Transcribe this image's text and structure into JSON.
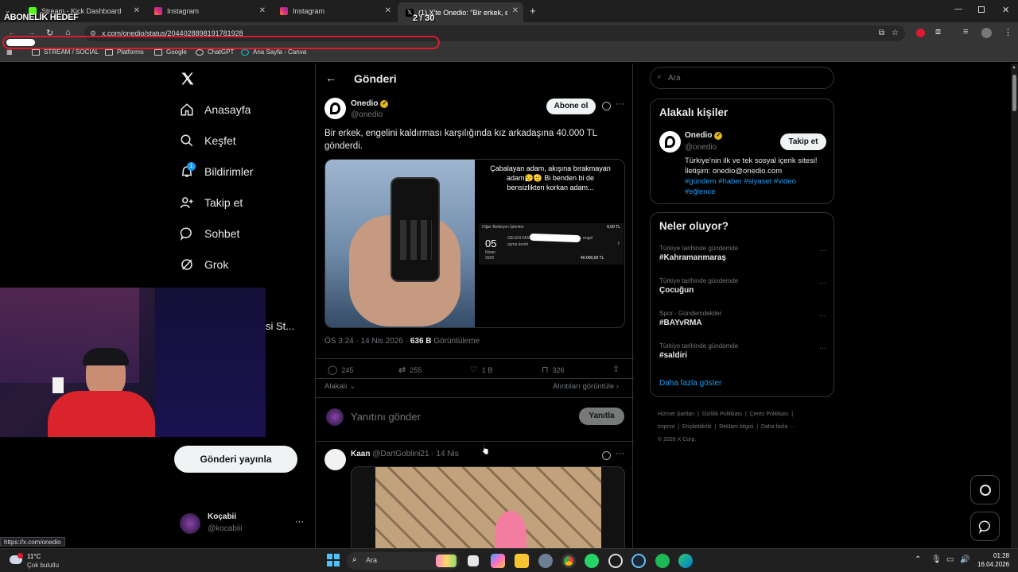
{
  "overlay": {
    "title": "ABONELİK HEDEF",
    "counter": "2 / 30",
    "progress": 0.067
  },
  "browser": {
    "tabs": [
      {
        "label": "Stream - Kick Dashboard",
        "active": false,
        "color": "#53fc18"
      },
      {
        "label": "Instagram",
        "active": false,
        "color": "#d6249f"
      },
      {
        "label": "Instagram",
        "active": false,
        "color": "#d6249f"
      },
      {
        "label": "(1) X'te Onedio: \"Bir erkek, eng",
        "active": true,
        "color": "#ffffff"
      }
    ],
    "url": "x.com/onedio/status/2044028898191781928",
    "bookmarks": [
      "STREAM / SOCIAL",
      "Platforms",
      "Google",
      "ChatGPT",
      "Ana Sayfa - Canva"
    ],
    "status_url": "https://x.com/onedio"
  },
  "nav": {
    "items": [
      "Anasayfa",
      "Keşfet",
      "Bildirimler",
      "Takip et",
      "Sohbet",
      "Grok"
    ],
    "notif_badge": "1",
    "post_button": "Gönderi yayınla",
    "partial_label": "si St...",
    "account": {
      "name": "Koçabii",
      "handle": "@kocabiii",
      "more": "···"
    }
  },
  "post": {
    "header_title": "Gönderi",
    "author": {
      "name": "Onedio",
      "handle": "@onedio"
    },
    "subscribe_label": "Abone ol",
    "text": "Bir erkek, engelini kaldırması karşılığında kız arkadaşına 40.000 TL gönderdi.",
    "image_caption": "Çabalayan adam, akışına bırakmayan adam😮‍💨🫡 Bi benden bi de bensizlikten korkan adam...",
    "bank": {
      "header_left": "Diğer Bekleyen İşlemler",
      "header_right": "0,00 TL",
      "day": "05",
      "month": "Nisan",
      "year": "2026",
      "line1": "GELEN FAST",
      "line1_suffix": "- engel",
      "line2": "açma ücreti",
      "amount": "40.000,00 TL"
    },
    "time": "ÖS 3:24 · 14 Nis 2026 ·",
    "views_count": "636 B",
    "views_label": "Görüntüleme",
    "stats": {
      "replies": "245",
      "reposts": "255",
      "likes": "1 B",
      "bookmarks": "326"
    },
    "relevant_label": "Alakalı",
    "quotes_label": "Alıntıları görüntüle",
    "reply_placeholder": "Yanıtını gönder",
    "reply_button": "Yanıtla"
  },
  "reply": {
    "name": "Kaan",
    "handle": "@DartGoblini21",
    "date": "· 14 Nis"
  },
  "sidebar": {
    "search_placeholder": "Ara",
    "people_title": "Alakalı kişiler",
    "person": {
      "name": "Onedio",
      "handle": "@onedio",
      "follow_label": "Takip et",
      "bio": "Türkiye'nin ilk ve tek sosyal içerik sitesi! İletişim: onedio@onedio.com",
      "tags": "#gündem #haber #siyaset #video #eğlence"
    },
    "trends_title": "Neler oluyor?",
    "trends": [
      {
        "category": "Türkiye tarihinde gündemde",
        "name": "#Kahramanmaraş"
      },
      {
        "category": "Türkiye tarihinde gündemde",
        "name": "Çocuğun"
      },
      {
        "category": "Spor · Gündemdekiler",
        "name": "#BAYvRMA"
      },
      {
        "category": "Türkiye tarihinde gündemde",
        "name": "#saldiri"
      }
    ],
    "show_more": "Daha fazla göster",
    "footer_links": [
      "Hizmet Şartları",
      "Gizlilik Politikası",
      "Çerez Politikası",
      "Imprint",
      "Erişilebilirlik",
      "Reklam bilgisi",
      "Daha fazla ···"
    ],
    "copyright": "© 2026 X Corp."
  },
  "taskbar": {
    "weather_temp": "11°C",
    "weather_desc": "Çok bulutlu",
    "search_placeholder": "Ara",
    "time": "01:28",
    "date": "16.04.2026"
  },
  "colors": {
    "accent": "#1d9bf0",
    "verified": "#e2b719",
    "overlay_red": "#e0192e"
  }
}
